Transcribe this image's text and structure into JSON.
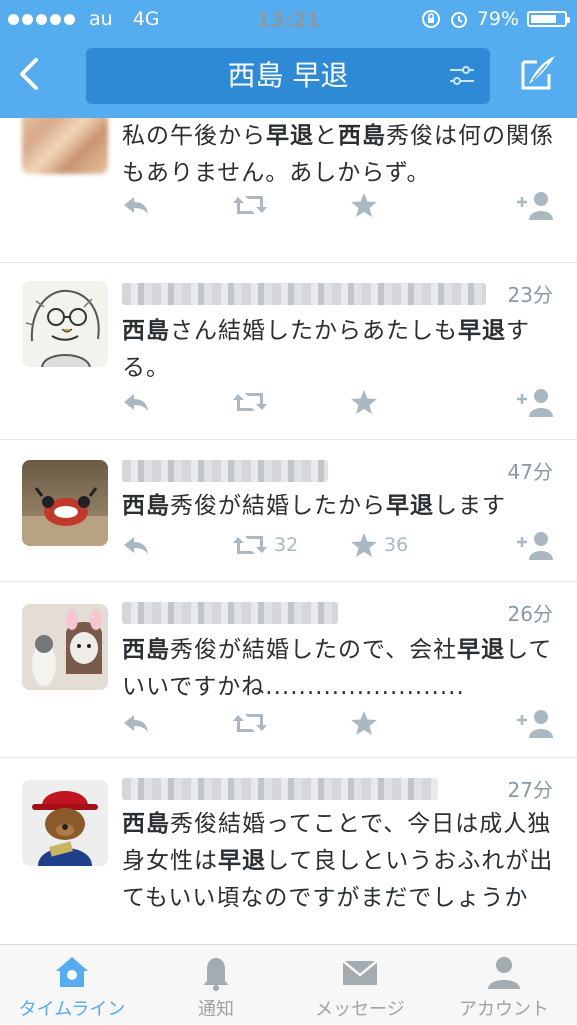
{
  "status_bar": {
    "carrier": "au",
    "network": "4G",
    "time": "13:21",
    "battery": "79%",
    "battery_level": 0.79
  },
  "header": {
    "back_icon": "chevron-left-icon",
    "search_query": "西島 早退",
    "filter_icon": "filter-sliders-icon",
    "compose_icon": "compose-icon"
  },
  "tweets": [
    {
      "time": "",
      "text_segments": [
        {
          "t": "私の午後から",
          "b": false
        },
        {
          "t": "早退",
          "b": true
        },
        {
          "t": "と",
          "b": false
        },
        {
          "t": "西島",
          "b": true
        },
        {
          "t": "秀俊は何の関係もありません。あしからず。",
          "b": false
        }
      ],
      "retweets": "",
      "favorites": ""
    },
    {
      "time": "23分",
      "text_segments": [
        {
          "t": "西島",
          "b": true
        },
        {
          "t": "さん結婚したからあたしも",
          "b": false
        },
        {
          "t": "早退",
          "b": true
        },
        {
          "t": "する。",
          "b": false
        }
      ],
      "retweets": "",
      "favorites": ""
    },
    {
      "time": "47分",
      "text_segments": [
        {
          "t": "西島",
          "b": true
        },
        {
          "t": "秀俊が結婚したから",
          "b": false
        },
        {
          "t": "早退",
          "b": true
        },
        {
          "t": "します",
          "b": false
        }
      ],
      "retweets": "32",
      "favorites": "36"
    },
    {
      "time": "26分",
      "text_segments": [
        {
          "t": "西島",
          "b": true
        },
        {
          "t": "秀俊が結婚したので、会社",
          "b": false
        },
        {
          "t": "早退",
          "b": true
        },
        {
          "t": "していいですかね........................",
          "b": false
        }
      ],
      "retweets": "",
      "favorites": ""
    },
    {
      "time": "27分",
      "text_segments": [
        {
          "t": "西島",
          "b": true
        },
        {
          "t": "秀俊結婚ってことで、今日は成人独身女性は",
          "b": false
        },
        {
          "t": "早退",
          "b": true
        },
        {
          "t": "して良しというおふれが出てもいい頃なのですがまだでしょうか",
          "b": false
        }
      ],
      "retweets": "",
      "favorites": ""
    }
  ],
  "tabbar": {
    "tabs": [
      {
        "label": "タイムライン",
        "icon": "home-icon",
        "active": true
      },
      {
        "label": "通知",
        "icon": "bell-icon",
        "active": false
      },
      {
        "label": "メッセージ",
        "icon": "envelope-icon",
        "active": false
      },
      {
        "label": "アカウント",
        "icon": "person-icon",
        "active": false
      }
    ]
  },
  "colors": {
    "brand": "#55acee",
    "search_bg": "#2f8ad6",
    "muted": "#aab8c2",
    "text": "#292f33"
  }
}
